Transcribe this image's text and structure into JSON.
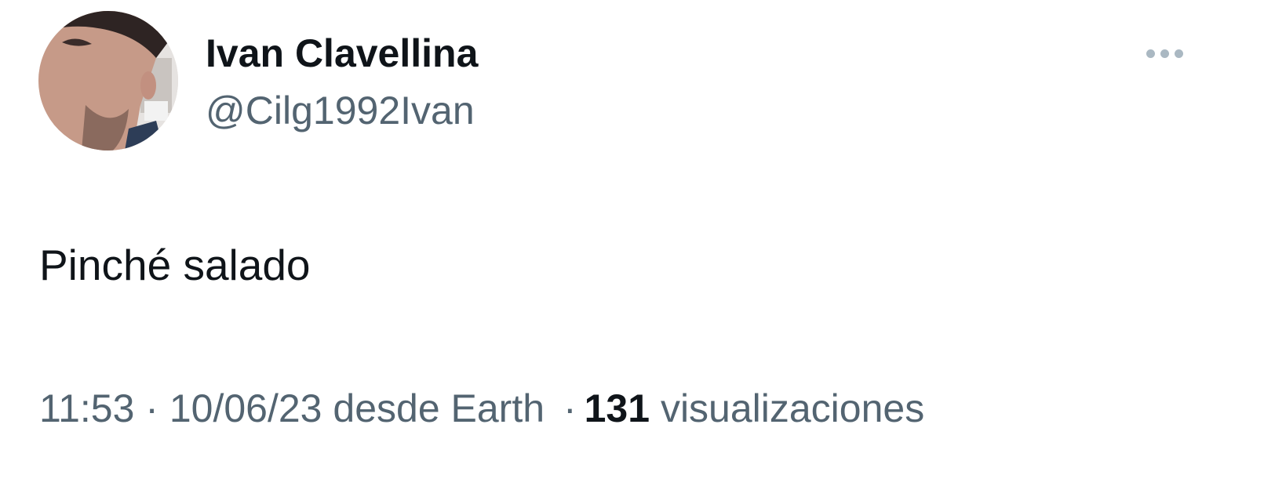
{
  "tweet": {
    "author": {
      "display_name": "Ivan Clavellina",
      "handle": "@Cilg1992Ivan"
    },
    "more_icon": "more-horizontal-icon",
    "text": "Pinché salado",
    "timestamp": "11:53 · 10/06/23",
    "source": "desde Earth",
    "separator": "·",
    "views_count": "131",
    "views_label": "visualizaciones"
  },
  "colors": {
    "primary_text": "#0f1419",
    "secondary_text": "#536471",
    "icon_gray": "#aab8c2",
    "background": "#ffffff"
  }
}
